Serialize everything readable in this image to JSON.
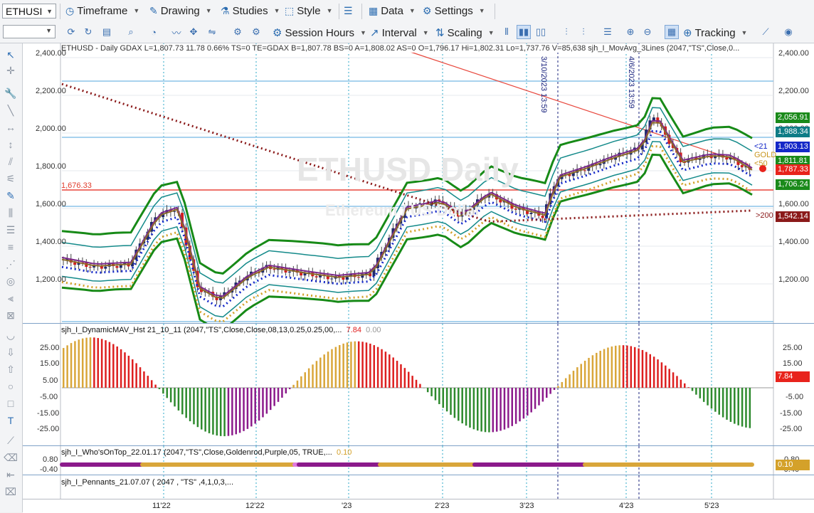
{
  "toolbar_top": {
    "symbol": "ETHUSI",
    "timeframe": "Timeframe",
    "drawing": "Drawing",
    "studies": "Studies",
    "style": "Style",
    "data": "Data",
    "settings": "Settings"
  },
  "toolbar_chart": {
    "session_hours": "Session Hours",
    "interval": "Interval",
    "scaling": "Scaling",
    "tracking": "Tracking"
  },
  "chart": {
    "header": "ETHUSD - Daily  GDAX  L=1,807.73  11.78  0.66%  TS=0  TE=GDAX  B=1,807.78  BS=0  A=1,808.02  AS=0  O=1,796.17  Hi=1,802.31  Lo=1,737.76  V=85,638  sjh_I_MovAvg_3Lines (2047,\"TS\",Close,0...",
    "watermark_title": "ETHUSD Daily",
    "watermark_sub": "Ethereum / US Dollar",
    "red_level_label": "1,676.33",
    "vline1_label": "3/10/2023 13:59",
    "vline2_label": "4/6/2023 13:59",
    "ma_labels": {
      "l21": "<21",
      "lgold": "GOLD",
      "l50": "<50",
      "l200": ">200"
    },
    "y_ticks": [
      "2,400.00",
      "2,200.00",
      "2,000.00",
      "1,800.00",
      "1,600.00",
      "1,400.00",
      "1,200.00"
    ],
    "price_badges": [
      {
        "text": "2,056.91",
        "color": "#1a8a1a"
      },
      {
        "text": "1,988.34",
        "color": "#0e7c86"
      },
      {
        "text": "1,903.13",
        "color": "#1428c8"
      },
      {
        "text": "1,811.81",
        "color": "#1a8a1a"
      },
      {
        "text": "1,787.33",
        "color": "#e8231c"
      },
      {
        "text": "1,706.24",
        "color": "#1a8a1a"
      },
      {
        "text": "1,542.14",
        "color": "#8b1a1a"
      }
    ]
  },
  "hist_panel": {
    "header": "sjh_I_DynamicMAV_Hst 21_10_11 (2047,\"TS\",Close,Close,08,13,0.25,0.25,00,...",
    "value1": "7.84",
    "value2": "0.00",
    "y_ticks": [
      "25.00",
      "15.00",
      "5.00",
      "-5.00",
      "-15.00",
      "-25.00"
    ],
    "badge": "7.84"
  },
  "whos_panel": {
    "header": "sjh_I_Who'sOnTop_22.01.17 (2047,\"TS\",Close,Goldenrod,Purple,05, TRUE,...",
    "value": "0.10",
    "y_ticks": [
      "0.80",
      "-0.40"
    ],
    "right_ticks": [
      "0.80",
      "-0.40"
    ],
    "badge": "0.10"
  },
  "pennants_panel": {
    "header": "sjh_I_Pennants_21.07.07 ( 2047 , \"TS\" ,4,1,0,3,..."
  },
  "x_axis": [
    "11'22",
    "12'22",
    "'23",
    "2'23",
    "3'23",
    "4'23",
    "5'23"
  ],
  "colors": {
    "up": "#1f2a6b",
    "down": "#d11f1f",
    "ma_green": "#178a17",
    "ma_teal": "#148a8a",
    "ma_blue": "#1428c8",
    "ma_gold": "#d4a12a",
    "ma_dark": "#8b1a1a",
    "hist_green": "#2d8a2d",
    "hist_purple": "#8b1a8b",
    "hist_gold": "#d9a63a",
    "hist_red": "#dd1f1f"
  },
  "icons": {
    "timeframe": "clock-icon",
    "drawing": "pencil-icon",
    "studies": "flask-icon",
    "style": "style-icon",
    "data": "grid-icon",
    "settings": "gear-icon",
    "tracking": "crosshair-icon"
  }
}
